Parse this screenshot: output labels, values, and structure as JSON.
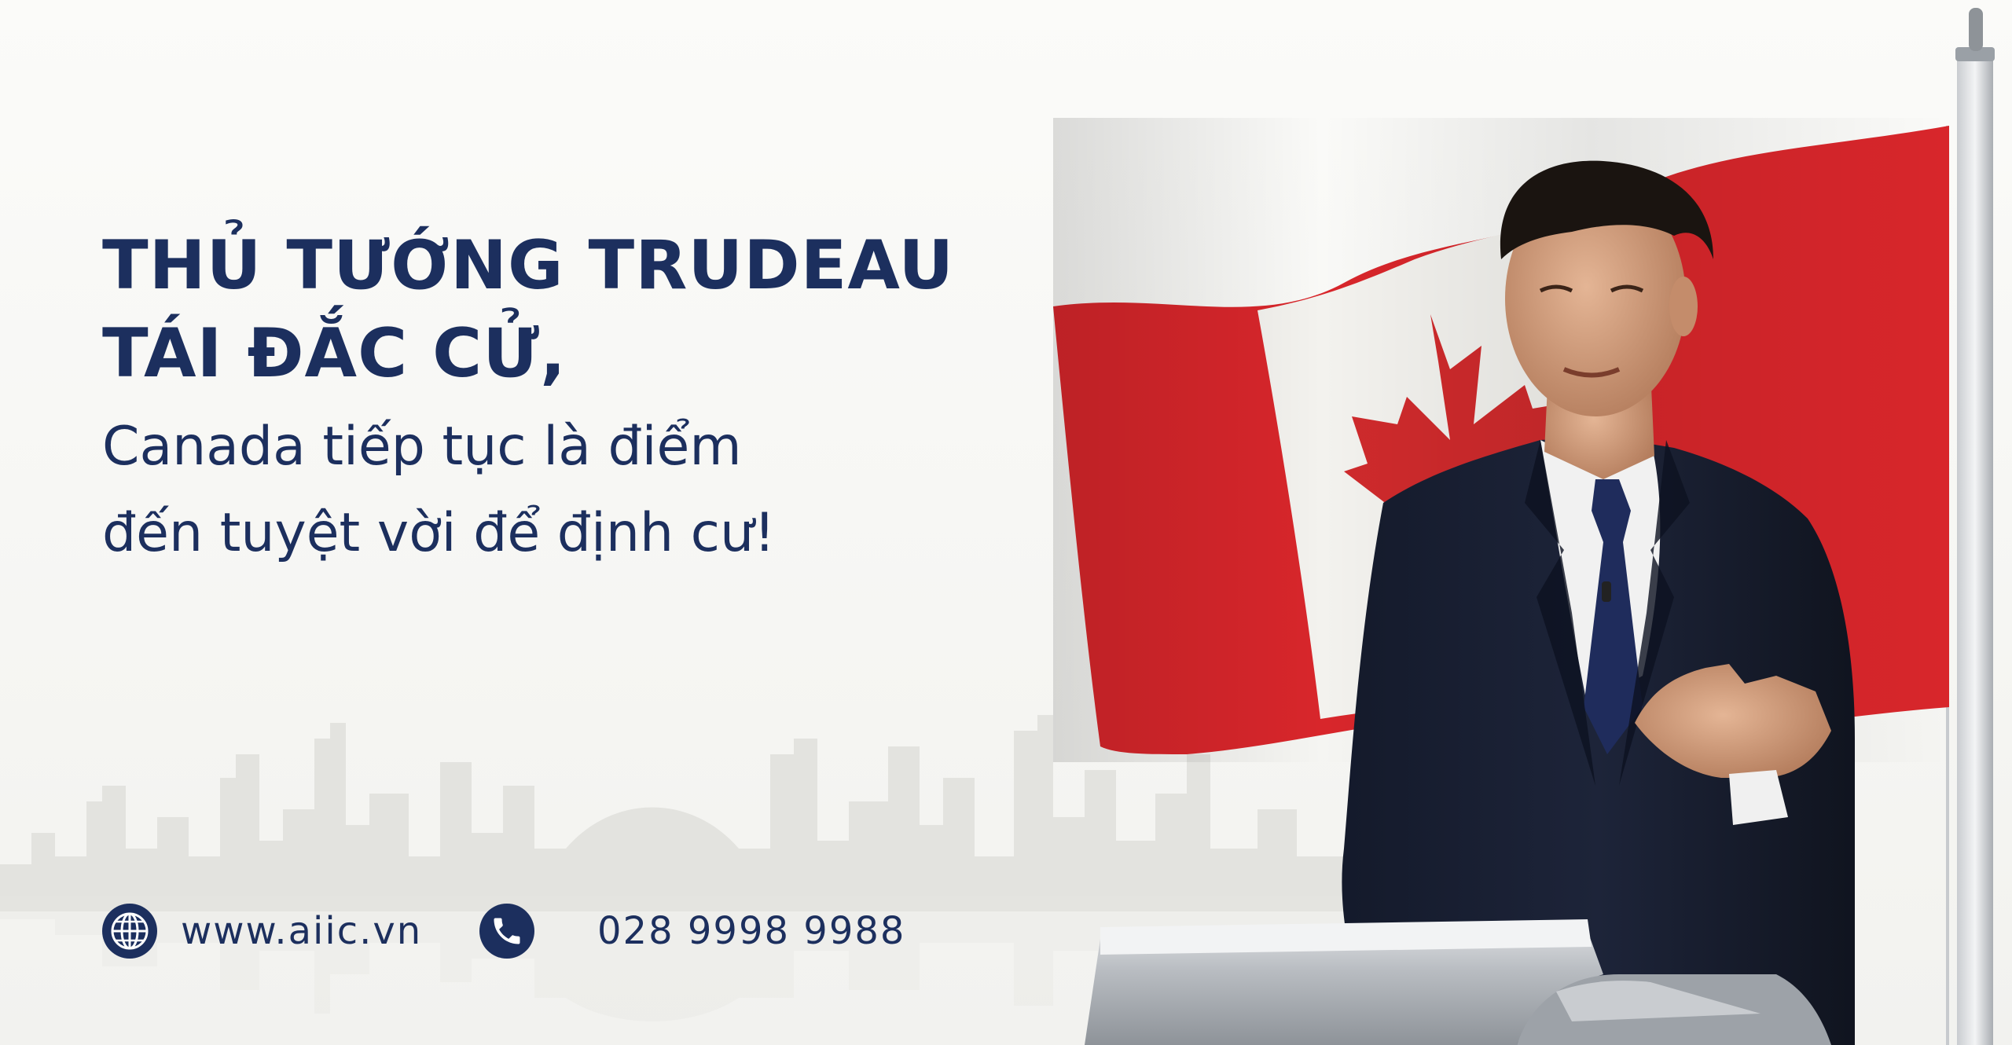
{
  "headline": {
    "line1": "THỦ TƯỚNG TRUDEAU",
    "line2": "TÁI ĐẮC CỬ,",
    "line3": "Canada tiếp tục là điểm",
    "line4": "đến tuyệt vời để định cư!"
  },
  "contacts": {
    "website": "www.aiic.vn",
    "website_icon": "globe-icon",
    "phone": "028 9998 9988",
    "phone_icon": "phone-icon"
  },
  "colors": {
    "brand_navy": "#1c2f5e",
    "flag_red": "#d8262b",
    "background": "#f7f7f4"
  }
}
